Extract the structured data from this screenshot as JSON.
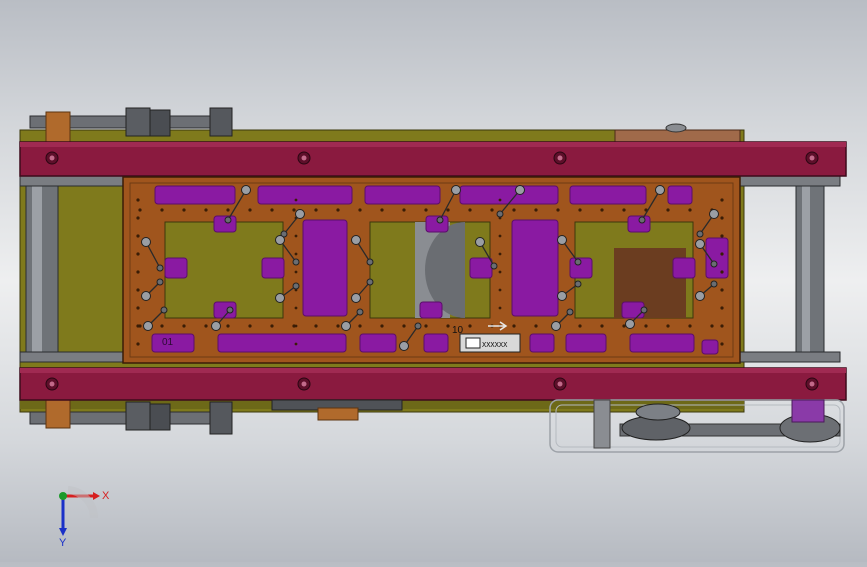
{
  "viewport": {
    "background_top": "#b9bdc4",
    "background_mid": "#eeeff0"
  },
  "colors": {
    "frame": "#8a1a3f",
    "frame_dark": "#5e0f2a",
    "base_plate": "#7f7a1c",
    "base_plate_dark": "#5f5b14",
    "pcb": "#a0551d",
    "pcb_dark": "#6e3a12",
    "pad": "#8a1aa2",
    "pad_dark": "#5b0d6b",
    "roller": "#7a7d82",
    "steel": "#6c6f74",
    "bronze": "#b06a2c"
  },
  "part": {
    "slot_labels": [
      "01",
      "10"
    ],
    "connector_label": "XXXXXX"
  },
  "axis_triad": {
    "x_label": "X",
    "y_label": "Y",
    "x_color": "#d61f1f",
    "y_color": "#1a30c8",
    "z_color": "#1c9a2a"
  }
}
